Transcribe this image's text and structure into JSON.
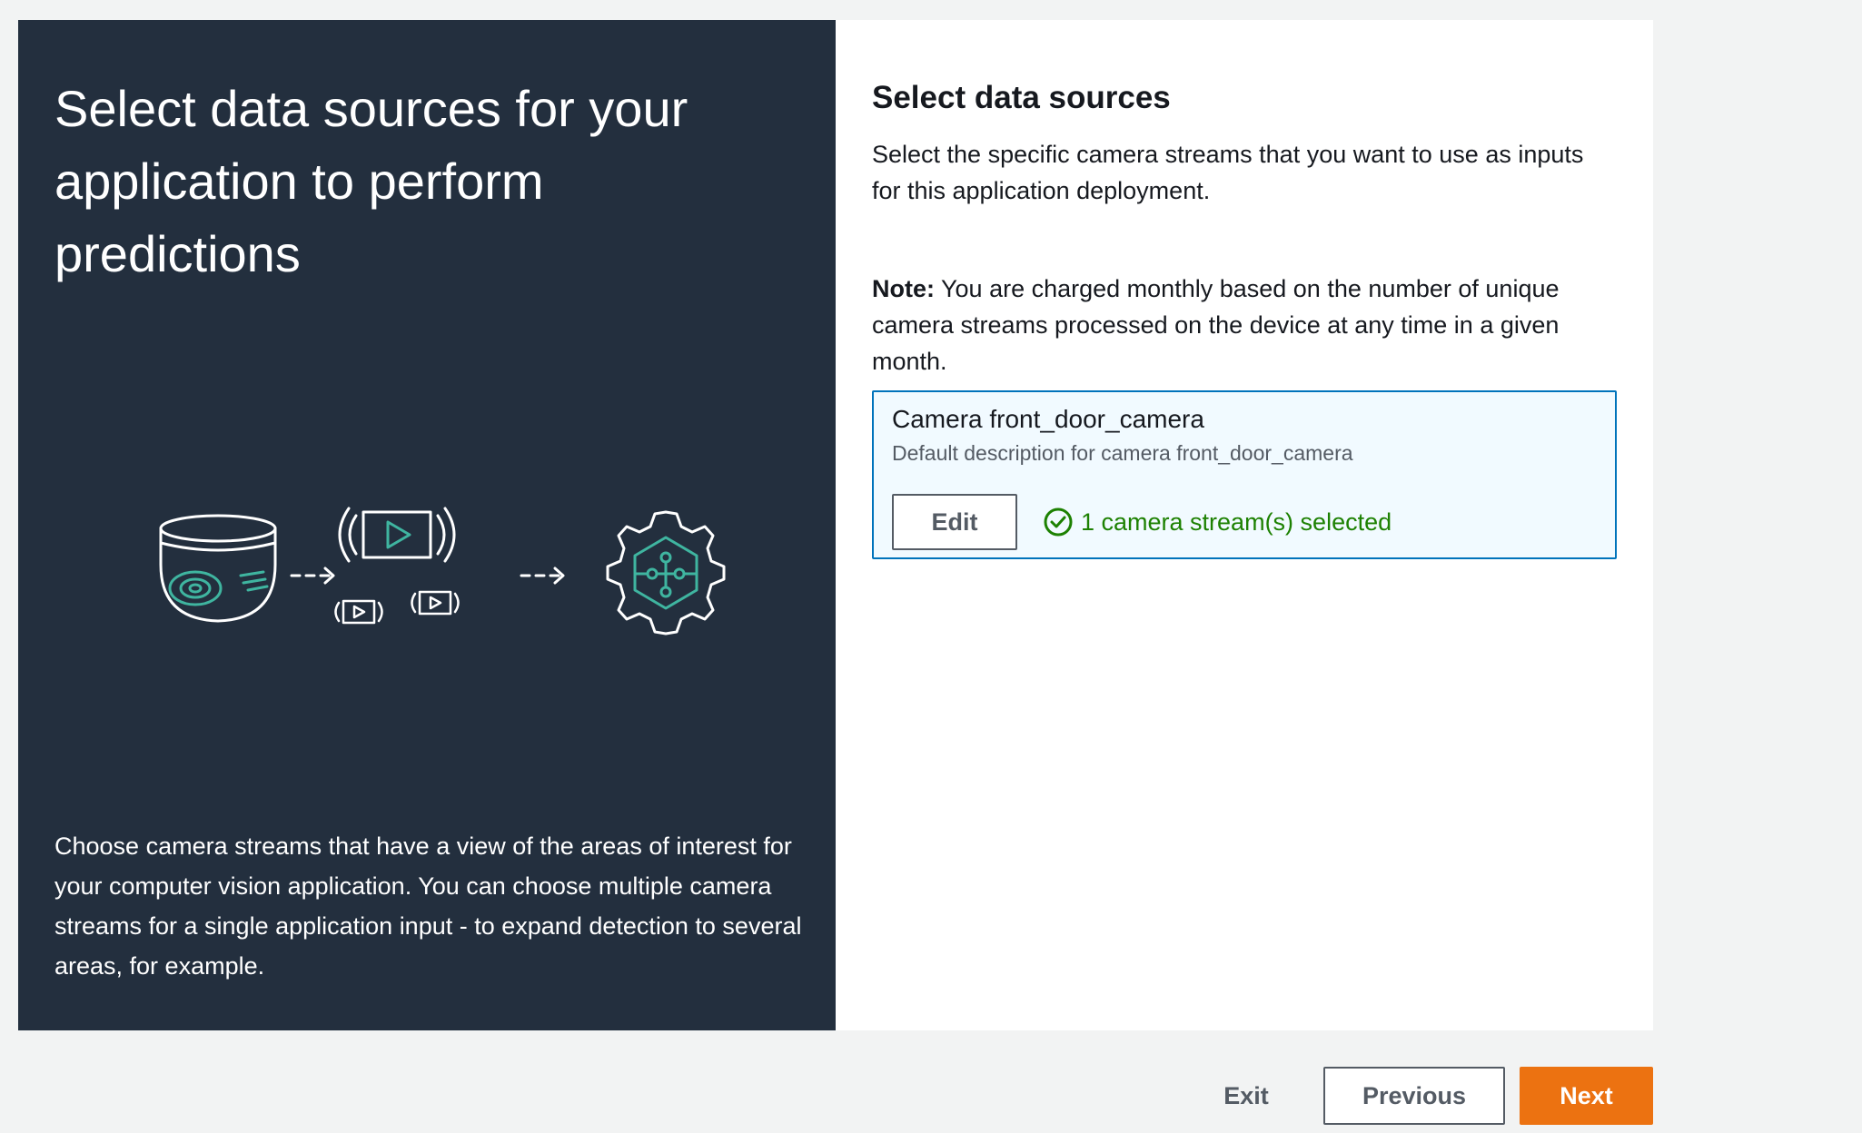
{
  "intro": {
    "title": "Select data sources for your application to perform predictions",
    "description": "Choose camera streams that have a view of the areas of interest for your computer vision application. You can choose multiple camera streams for a single application input - to expand detection to several areas, for example.",
    "illustration_icons": [
      "camera-icon",
      "arrow-icon",
      "video-streams-icon",
      "arrow-icon",
      "gear-circuit-icon"
    ]
  },
  "main": {
    "title": "Select data sources",
    "description": "Select the specific camera streams that you want to use as inputs for this application deployment.",
    "note_label": "Note:",
    "note_text": " You are charged monthly based on the number of unique camera streams processed on the device at any time in a given month.",
    "camera": {
      "name": "Camera front_door_camera",
      "description": "Default description for camera front_door_camera",
      "edit_label": "Edit",
      "status_text": "1 camera stream(s) selected",
      "status_icon": "check-circle-icon"
    }
  },
  "footer": {
    "exit_label": "Exit",
    "previous_label": "Previous",
    "next_label": "Next"
  },
  "colors": {
    "left_panel_bg": "#232f3e",
    "accent_orange": "#ec7211",
    "success_green": "#1d8102",
    "selection_blue": "#0073bb",
    "illustration_teal": "#3fb5a0"
  }
}
